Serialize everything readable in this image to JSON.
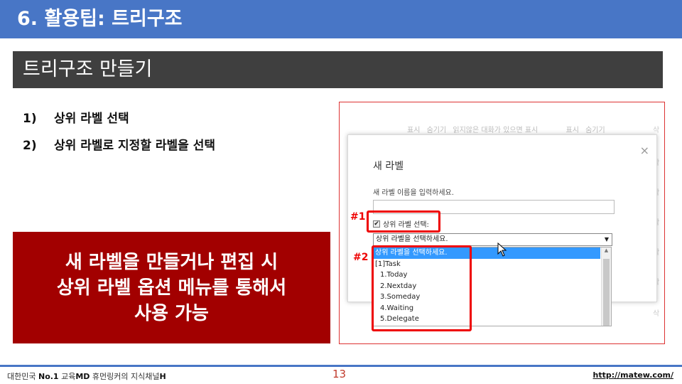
{
  "header": {
    "title": "6. 활용팁: 트리구조"
  },
  "section": {
    "title": "트리구조 만들기"
  },
  "steps": [
    {
      "num": "1)",
      "text": "상위 라벨 선택"
    },
    {
      "num": "2)",
      "text": "상위 라벨로 지정할 라벨을 선택"
    }
  ],
  "callout": {
    "line1": "새 라벨을 만들거나 편집 시",
    "line2": "상위 라벨 옵션 메뉴를 통해서",
    "line3": "사용 가능"
  },
  "screenshot": {
    "bg_row": {
      "show1": "표시",
      "hide1": "숨기기",
      "unread_note": "읽지않은 대화가 있으면 표시",
      "show2": "표시",
      "hide2": "숨기기"
    },
    "bg_side": {
      "label": "삭"
    },
    "dialog": {
      "close": "×",
      "title": "새 라벨",
      "name_label": "새 라벨 이름을 입력하세요.",
      "name_value": "",
      "parent_checkbox_label": "상위 라벨 선택:",
      "parent_select_value": "상위 라벨을 선택하세요."
    },
    "listbox": {
      "items": [
        "상위 라벨을 선택하세요.",
        "[1]Task",
        "1.Today",
        "2.Nextday",
        "3.Someday",
        "4.Waiting",
        "5.Delegate"
      ],
      "selected_index": 0
    },
    "tags": {
      "tag1": "#1",
      "tag2": "#2"
    },
    "colors": {
      "highlight": "#e00000",
      "selection": "#3399ff"
    }
  },
  "footer": {
    "left_prefix": "대한민국",
    "left_bold1": "No.1",
    "left_mid": "교육",
    "left_bold2": "MD",
    "left_suffix": "휴먼링커의 지식채널",
    "left_bold3": "H",
    "page_number": "13",
    "url": "http://matew.com/"
  },
  "theme": {
    "header_bg": "#4876c6",
    "section_bg": "#3f3f3f",
    "callout_bg": "#a20000"
  }
}
